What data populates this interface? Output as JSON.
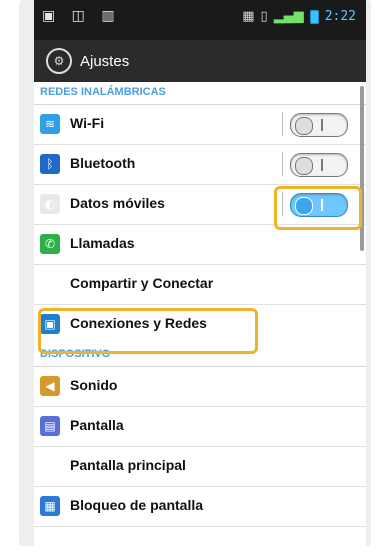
{
  "status_bar": {
    "left_icons_text": "▣ ◫ ▥",
    "time": "2:22"
  },
  "header": {
    "title": "Ajustes"
  },
  "sections": [
    {
      "label": "REDES INALÁMBRICAS",
      "items": [
        {
          "label": "Wi-Fi",
          "toggle": "off",
          "icon": "wifi-icon"
        },
        {
          "label": "Bluetooth",
          "toggle": "off",
          "icon": "bluetooth-icon"
        },
        {
          "label": "Datos móviles",
          "toggle": "on",
          "icon": "mobile-data-icon"
        },
        {
          "label": "Llamadas",
          "icon": "phone-icon"
        },
        {
          "label": "Compartir y Conectar",
          "icon": "share-connect-icon"
        },
        {
          "label": "Conexiones y Redes",
          "icon": "network-icon"
        }
      ]
    },
    {
      "label": "DISPOSITIVO",
      "items": [
        {
          "label": "Sonido",
          "icon": "sound-icon"
        },
        {
          "label": "Pantalla",
          "icon": "display-icon"
        },
        {
          "label": "Pantalla principal",
          "icon": "home-icon"
        },
        {
          "label": "Bloqueo de pantalla",
          "icon": "lock-screen-icon"
        }
      ]
    }
  ],
  "colors": {
    "accent_blue": "#4a9fd8",
    "highlight": "#f1b12d"
  }
}
